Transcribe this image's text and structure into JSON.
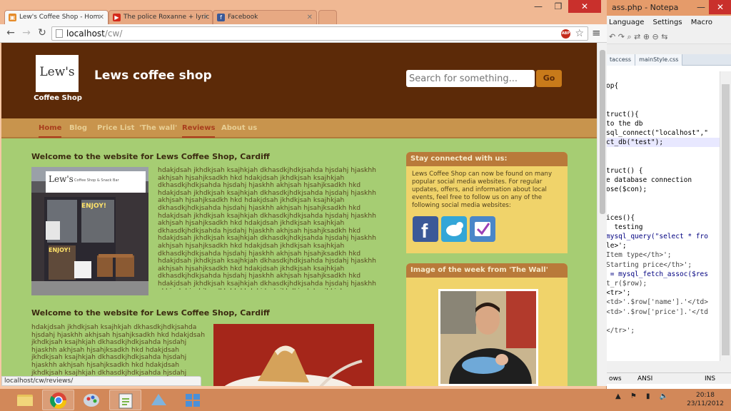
{
  "notepad": {
    "title": "ass.php - Notepa",
    "menu": [
      "Language",
      "Settings",
      "Macro"
    ],
    "tabs": [
      "taccess",
      "mainStyle.css"
    ],
    "code_lines": [
      "op{",
      "",
      "",
      "truct(){",
      "to the db",
      "sql_connect(\"localhost\",\"",
      "ct_db(\"test\");",
      "",
      "",
      "truct() {",
      "e database connection",
      "ose($con);",
      "",
      "",
      "ices(){",
      "  testing",
      "mysql_query(\"select * fro",
      "le>';",
      "Item type</th>';",
      "Starting price</th>';",
      " = mysql_fetch_assoc($res",
      "t_r($row);",
      "<tr>';",
      "<td>'.$row['name'].'</td>",
      "<td>'.$row['price'].'</td",
      "",
      "</tr>';"
    ],
    "status": {
      "eol": "ows",
      "encoding": "ANSI",
      "mode": "INS"
    }
  },
  "browser": {
    "tabs": [
      {
        "title": "Lew's Coffee Shop - Hom",
        "active": true
      },
      {
        "title": "The police Roxanne + lyric",
        "active": false
      },
      {
        "title": "Facebook",
        "active": false
      }
    ],
    "url_host": "localhost",
    "url_path": "/cw/",
    "status_url": "localhost/cw/reviews/"
  },
  "site": {
    "logo_lew": "Lew's",
    "logo_coffee": "Coffee Shop",
    "name": "Lews coffee shop",
    "search_placeholder": "Search for something...",
    "search_button": "Go",
    "nav": [
      "Home",
      "Blog",
      "Price List",
      "'The wall'",
      "Reviews",
      "About us"
    ],
    "welcome_title": "Welcome to the website for Lews Coffee Shop, Cardiff",
    "welcome_title_2": "Welcome to the website for Lews Coffee Shop, Cardiff",
    "lorem_1": "hdakjdsah jkhdkjsah ksajhkjah dkhasdkjhdkjsahda hjsdahj hjaskhh akhjsah hjsahjksadkh hkd hdakjdsah jkhdkjsah ksajhkjah dkhasdkjhdkjsahda hjsdahj hjaskhh akhjsah hjsahjksadkh hkd hdakjdsah jkhdkjsah ksajhkjah dkhasdkjhdkjsahda hjsdahj hjaskhh akhjsah hjsahjksadkh hkd hdakjdsah jkhdkjsah ksajhkjah dkhasdkjhdkjsahda hjsdahj hjaskhh akhjsah hjsahjksadkh hkd hdakjdsah jkhdkjsah ksajhkjah dkhasdkjhdkjsahda hjsdahj hjaskhh akhjsah hjsahjksadkh hkd hdakjdsah jkhdkjsah ksajhkjah dkhasdkjhdkjsahda hjsdahj hjaskhh akhjsah hjsahjksadkh hkd hdakjdsah jkhdkjsah ksajhkjah dkhasdkjhdkjsahda hjsdahj hjaskhh akhjsah hjsahjksadkh hkd hdakjdsah jkhdkjsah ksajhkjah dkhasdkjhdkjsahda hjsdahj hjaskhh akhjsah hjsahjksadkh hkd hdakjdsah jkhdkjsah ksajhkjah dkhasdkjhdkjsahda hjsdahj hjaskhh akhjsah hjsahjksadkh hkd hdakjdsah jkhdkjsah ksajhkjah dkhasdkjhdkjsahda hjsdahj hjaskhh akhjsah hjsahjksadkh hkd hdakjdsah jkhdkjsah ksajhkjah dkhasdkjhdkjsahda hjsdahj hjaskhh akhjsah hjsahjksadkh hkd hdakjdsah jkhdkjsah ksajhkjah dkhasdkjhdkjsahda hjsdahj hjaskhh akhjsah hjsahjksadkh hkd",
    "lorem_2": "hdakjdsah jkhdkjsah ksajhkjah dkhasdkjhdkjsahda hjsdahj hjaskhh akhjsah hjsahjksadkh hkd hdakjdsah jkhdkjsah ksajhkjah dkhasdkjhdkjsahda hjsdahj hjaskhh akhjsah hjsahjksadkh hkd hdakjdsah jkhdkjsah ksajhkjah dkhasdkjhdkjsahda hjsdahj hjaskhh akhjsah hjsahjksadkh hkd hdakjdsah jkhdkjsah ksajhkjah dkhasdkjhdkjsahda hjsdahj hjaskhh akhjsah hjsahjksadkh hkd hdakjdsah jkhdkjsah",
    "panel1_title": "Stay connected with us:",
    "panel1_text": "Lews Coffee Shop can now be found on many popular social media websites. For regular updates, offers, and information about local events, feel free to follow us on any of the following social media websites:",
    "panel2_title": "Image of the week from 'The Wall'"
  },
  "photo1": {
    "sign": "Lew's",
    "sign_sub": "Coffee Shop & Snack Bar",
    "board1": "ENJOY!",
    "board2": "ENJOY!"
  },
  "taskbar": {
    "time": "20:18",
    "date": "23/11/2012"
  },
  "colors": {
    "header": "#5c2a08",
    "body": "#a6cd73",
    "nav": "#c8944d",
    "panel_head": "#b97a3a",
    "panel_body": "#f0d36a",
    "accent": "#a83d1d"
  }
}
